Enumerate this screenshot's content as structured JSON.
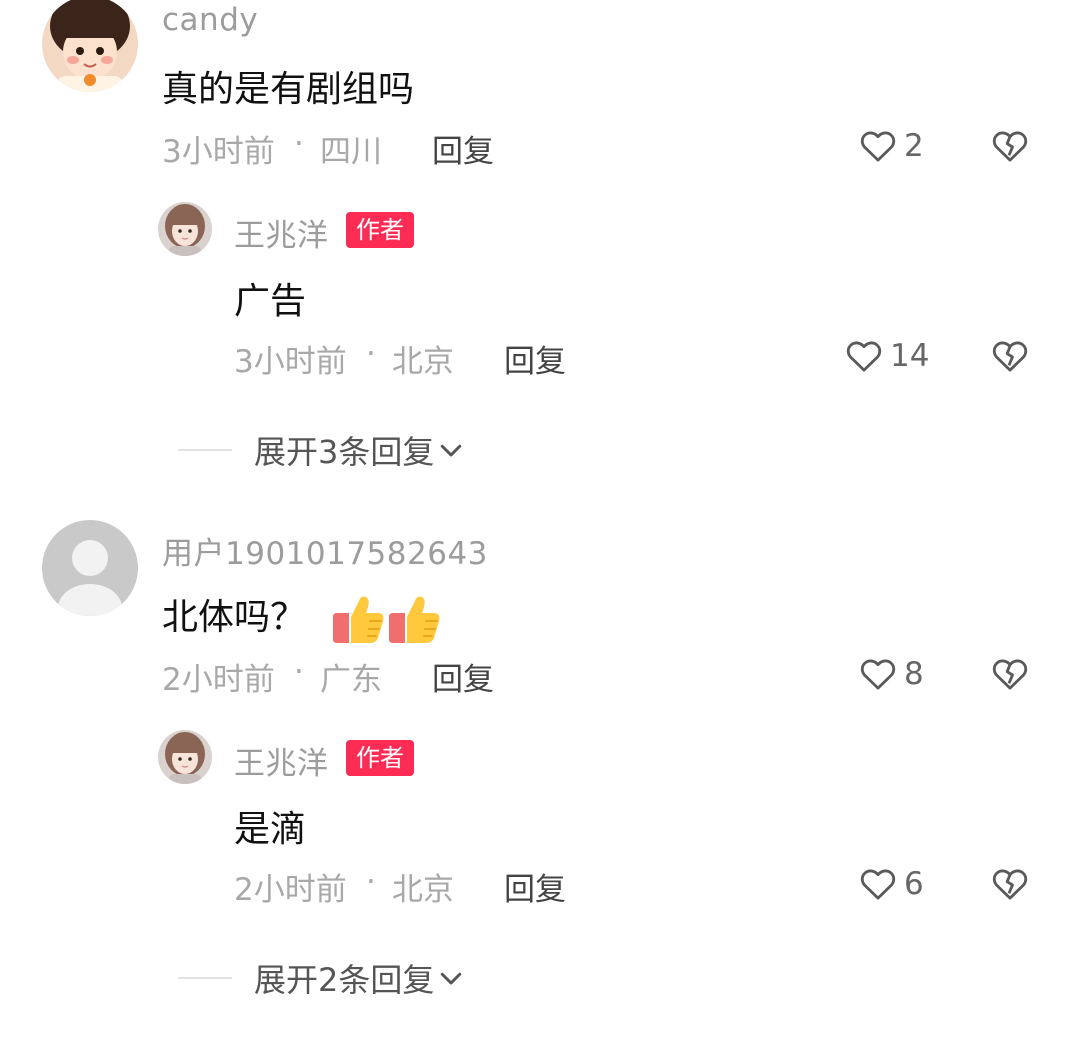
{
  "comments": [
    {
      "username": "candy",
      "text": "真的是有剧组吗",
      "time": "3小时前",
      "location": "四川",
      "reply_label": "回复",
      "likes": "2",
      "reply": {
        "username": "王兆洋",
        "badge": "作者",
        "text": "广告",
        "time": "3小时前",
        "location": "北京",
        "reply_label": "回复",
        "likes": "14"
      },
      "expand_label": "展开3条回复"
    },
    {
      "username": "用户1901017582643",
      "text": "北体吗？",
      "emoji": [
        "thumbs-up",
        "thumbs-up"
      ],
      "time": "2小时前",
      "location": "广东",
      "reply_label": "回复",
      "likes": "8",
      "reply": {
        "username": "王兆洋",
        "badge": "作者",
        "text": "是滴",
        "time": "2小时前",
        "location": "北京",
        "reply_label": "回复",
        "likes": "6"
      },
      "expand_label": "展开2条回复"
    }
  ],
  "separator": "·",
  "colors": {
    "badge": "#fe2c55",
    "username": "#9c9c9c",
    "meta": "#a8a8a8",
    "text": "#111111"
  }
}
